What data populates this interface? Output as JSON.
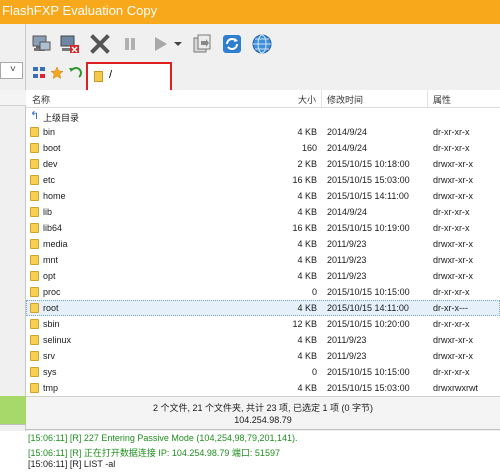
{
  "window": {
    "title": "FlashFXP Evaluation Copy"
  },
  "left_panel": {
    "dropdown_arrow": "˅"
  },
  "toolbar": {
    "buttons": [
      {
        "icon": "connect-icon"
      },
      {
        "icon": "disconnect-icon"
      },
      {
        "icon": "abort-icon"
      },
      {
        "icon": "pause-icon"
      },
      {
        "icon": "play-icon"
      },
      {
        "icon": "dropdown-arrow-icon"
      },
      {
        "icon": "transfer-queue-icon"
      },
      {
        "icon": "refresh-icon"
      },
      {
        "icon": "globe-icon"
      }
    ]
  },
  "path": {
    "value": "/"
  },
  "columns": {
    "name": "名称",
    "size": "大小",
    "modified": "修改时间",
    "attributes": "属性"
  },
  "parent_dir": "上级目录",
  "files": [
    {
      "name": "bin",
      "size": "4 KB",
      "modified": "2014/9/24",
      "attr": "dr-xr-xr-x"
    },
    {
      "name": "boot",
      "size": "160",
      "modified": "2014/9/24",
      "attr": "dr-xr-xr-x"
    },
    {
      "name": "dev",
      "size": "2 KB",
      "modified": "2015/10/15 10:18:00",
      "attr": "drwxr-xr-x"
    },
    {
      "name": "etc",
      "size": "16 KB",
      "modified": "2015/10/15 15:03:00",
      "attr": "drwxr-xr-x"
    },
    {
      "name": "home",
      "size": "4 KB",
      "modified": "2015/10/15 14:11:00",
      "attr": "drwxr-xr-x"
    },
    {
      "name": "lib",
      "size": "4 KB",
      "modified": "2014/9/24",
      "attr": "dr-xr-xr-x"
    },
    {
      "name": "lib64",
      "size": "16 KB",
      "modified": "2015/10/15 10:19:00",
      "attr": "dr-xr-xr-x"
    },
    {
      "name": "media",
      "size": "4 KB",
      "modified": "2011/9/23",
      "attr": "drwxr-xr-x"
    },
    {
      "name": "mnt",
      "size": "4 KB",
      "modified": "2011/9/23",
      "attr": "drwxr-xr-x"
    },
    {
      "name": "opt",
      "size": "4 KB",
      "modified": "2011/9/23",
      "attr": "drwxr-xr-x"
    },
    {
      "name": "proc",
      "size": "0",
      "modified": "2015/10/15 10:15:00",
      "attr": "dr-xr-xr-x"
    },
    {
      "name": "root",
      "size": "4 KB",
      "modified": "2015/10/15 14:11:00",
      "attr": "dr-xr-x---"
    },
    {
      "name": "sbin",
      "size": "12 KB",
      "modified": "2015/10/15 10:20:00",
      "attr": "dr-xr-xr-x"
    },
    {
      "name": "selinux",
      "size": "4 KB",
      "modified": "2011/9/23",
      "attr": "drwxr-xr-x"
    },
    {
      "name": "srv",
      "size": "4 KB",
      "modified": "2011/9/23",
      "attr": "drwxr-xr-x"
    },
    {
      "name": "sys",
      "size": "0",
      "modified": "2015/10/15 10:15:00",
      "attr": "dr-xr-xr-x"
    },
    {
      "name": "tmp",
      "size": "4 KB",
      "modified": "2015/10/15 15:03:00",
      "attr": "drwxrwxrwt"
    }
  ],
  "selected_row": "root",
  "status": {
    "summary": "2 个文件, 21 个文件夹, 共计 23 项, 已选定 1 项 (0 字节)",
    "host": "104.254.98.79"
  },
  "log": [
    {
      "text": "[15:06:11] [R] 227 Entering Passive Mode (104,254,98,79,201,141).",
      "color": "#1f8f1f"
    },
    {
      "text": "[15:06:11] [R] 正在打开数据连接 IP: 104.254.98.79 端口: 51597",
      "color": "#1f8f1f"
    },
    {
      "text": "[15:06:11] [R] LIST -al",
      "color": "#1a1a1a"
    }
  ],
  "colors": {
    "title_bar": "#f7a81b",
    "selection": "#e5f0fb",
    "highlight_box": "#e02020",
    "left_status_green": "#a6d96a",
    "log_green": "#1f8f1f"
  }
}
